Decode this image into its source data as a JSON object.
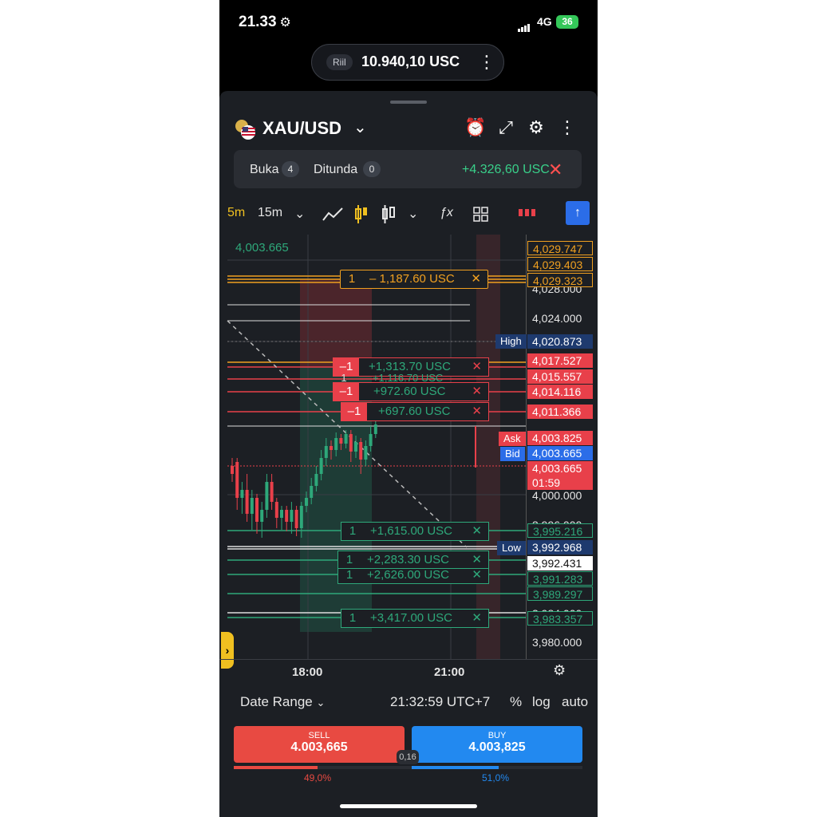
{
  "status": {
    "time": "21.33",
    "network": "4G",
    "battery": "36"
  },
  "account": {
    "type": "Riil",
    "balance": "10.940,10 USC"
  },
  "symbol": {
    "name": "XAU/USD"
  },
  "positions": {
    "open_label": "Buka",
    "open_count": "4",
    "pending_label": "Ditunda",
    "pending_count": "0",
    "total_pl": "+4.326,60 USC"
  },
  "toolbar": {
    "tf_active": "5m",
    "tf_alt": "15m"
  },
  "chart": {
    "last_label": "4,003.665",
    "axis_labels": [
      "4,028.000",
      "4,024.000",
      "4,000.000",
      "3,996.000",
      "3,984.000",
      "3,980.000"
    ],
    "price_tags": {
      "p1": "4,029.747",
      "p2": "4,029.403",
      "p3": "4,029.323",
      "high_label": "High",
      "high": "4,020.873",
      "r1": "4,017.527",
      "r2": "4,015.557",
      "r3": "4,014.116",
      "r4": "4,011.366",
      "ask_label": "Ask",
      "ask": "4,003.825",
      "bid_label": "Bid",
      "bid": "4,003.665",
      "last": "4,003.665",
      "countdown": "01:59",
      "g1": "3,995.216",
      "low_label": "Low",
      "low": "3,992.968",
      "w1": "3,992.431",
      "g2": "3,991.283",
      "g3": "3,989.297",
      "g4": "3,983.357"
    },
    "orders": [
      {
        "qty": "1",
        "pl": "– 1,187.60 USC"
      },
      {
        "qty": "–1",
        "pl": "+1,313.70 USC"
      },
      {
        "qty": "1",
        "pl": "+1,116.70 USC"
      },
      {
        "qty": "–1",
        "pl": "+972.60 USC"
      },
      {
        "qty": "–1",
        "pl": "+697.60 USC"
      },
      {
        "qty": "1",
        "pl": "+1,615.00 USC"
      },
      {
        "qty": "1",
        "pl": "+2,283.30 USC"
      },
      {
        "qty": "1",
        "pl": "+2,626.00 USC"
      },
      {
        "qty": "1",
        "pl": "+3,417.00 USC"
      }
    ],
    "x_labels": [
      "18:00",
      "21:00"
    ]
  },
  "bottom": {
    "date_range": "Date Range",
    "clock": "21:32:59 UTC+7",
    "pct": "%",
    "log": "log",
    "auto": "auto"
  },
  "trade": {
    "sell_label": "SELL",
    "sell_price": "4.003,665",
    "buy_label": "BUY",
    "buy_price": "4.003,825",
    "spread": "0,16",
    "sell_pct": "49,0%",
    "buy_pct": "51,0%"
  }
}
